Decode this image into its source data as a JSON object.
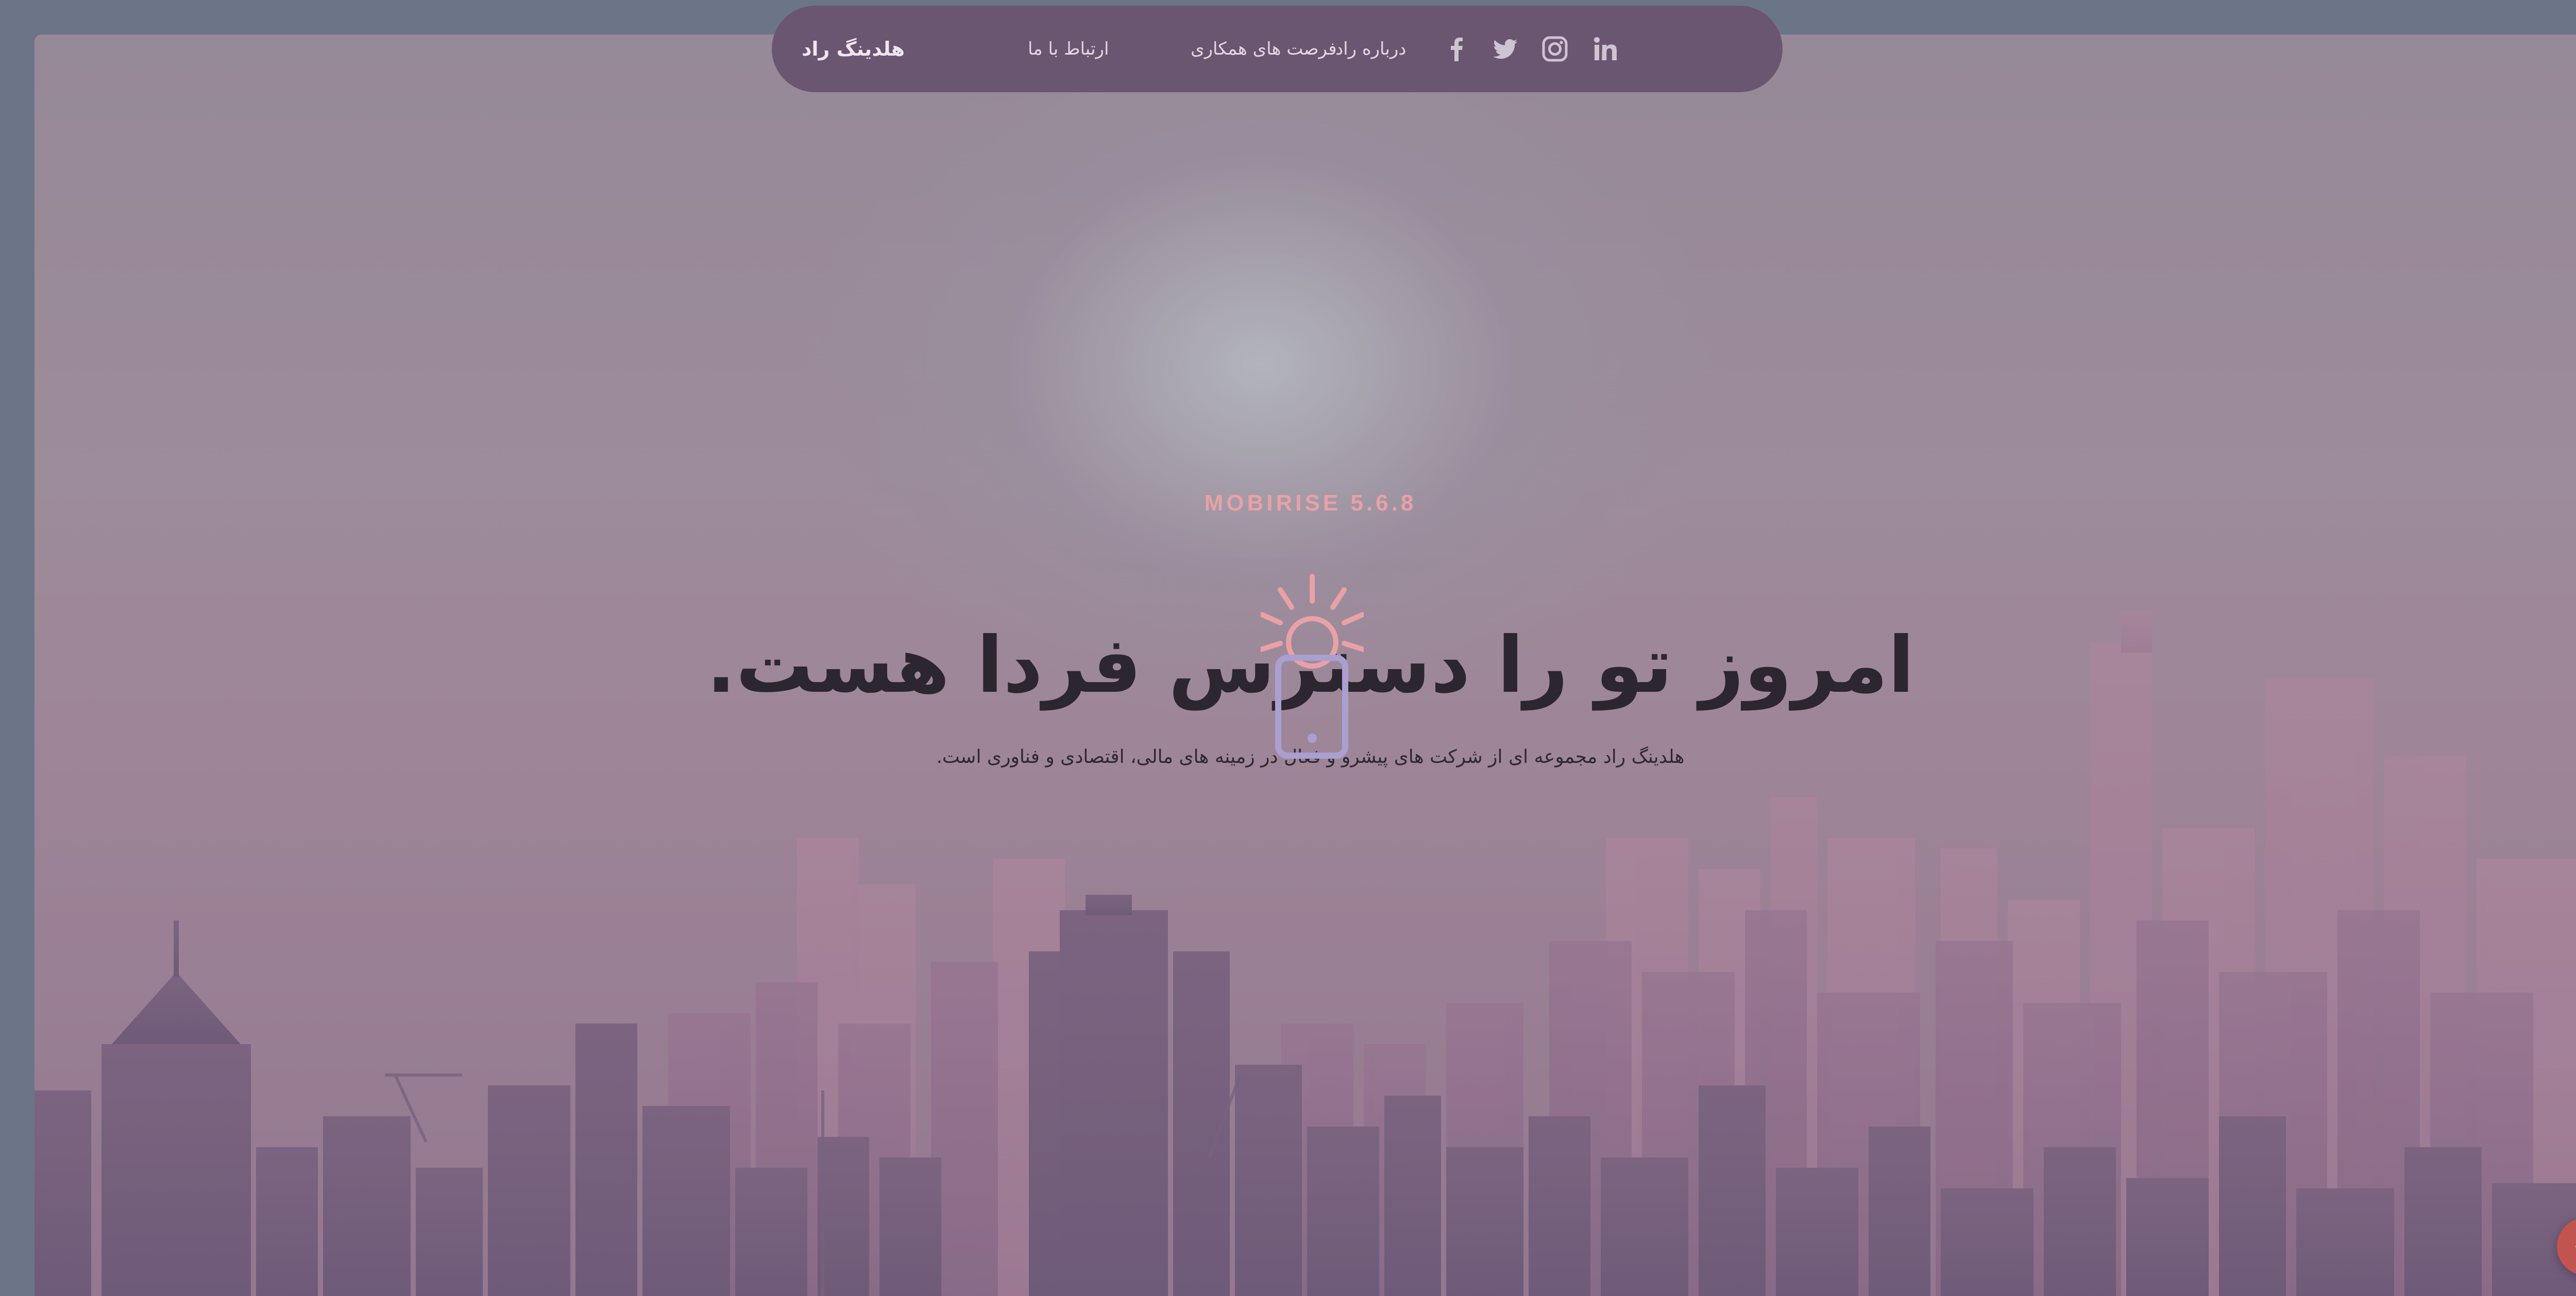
{
  "navbar": {
    "brand": "هلدینگ راد",
    "menu": [
      "ارتباط با ما",
      "فرصت های همکاری",
      "درباره راد"
    ],
    "social_icons": [
      "facebook-icon",
      "twitter-icon",
      "instagram-icon",
      "linkedin-icon"
    ]
  },
  "hero": {
    "tagline": "MOBIRISE  5.6.8",
    "title": "امروز تو را دسترس فردا هست.",
    "subtitle": "هلدینگ راد مجموعه ای از شرکت های پیشرو و فعال در زمینه های مالی، اقتصادی و فناوری است."
  },
  "fab": {
    "icon": "plus-icon"
  },
  "colors": {
    "navbar_bg": "#6a5670",
    "tagline": "#e9a1a6",
    "fab": "#c2544f",
    "page_bg": "#6b7587"
  }
}
